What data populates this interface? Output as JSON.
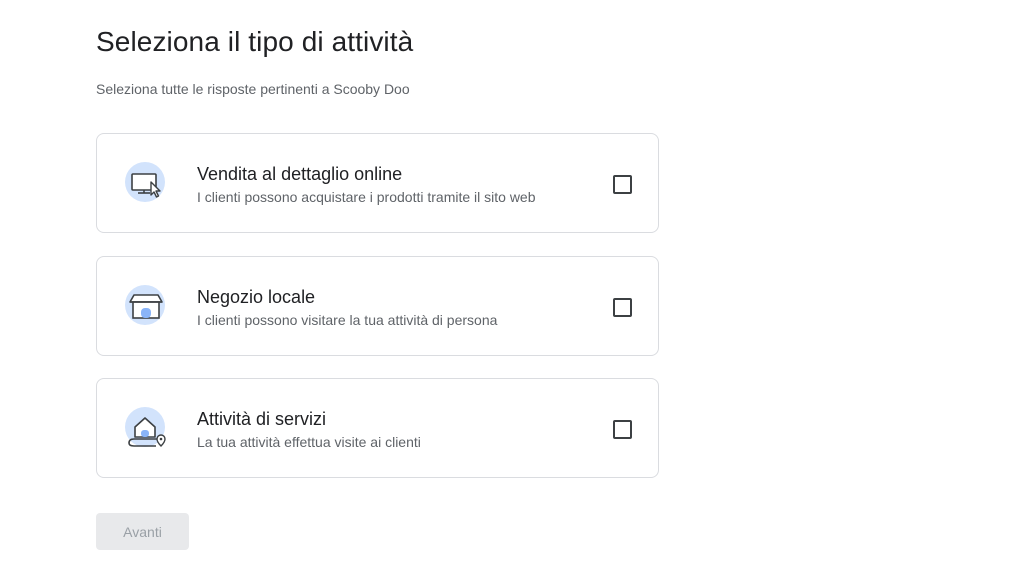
{
  "header": {
    "title": "Seleziona il tipo di attività",
    "subtitle": "Seleziona tutte le risposte pertinenti a Scooby Doo"
  },
  "options": [
    {
      "icon": "computer-cursor-icon",
      "title": "Vendita al dettaglio online",
      "description": "I clienti possono acquistare i prodotti tramite il sito web",
      "checked": false
    },
    {
      "icon": "storefront-icon",
      "title": "Negozio locale",
      "description": "I clienti possono visitare la tua attività di persona",
      "checked": false
    },
    {
      "icon": "house-location-icon",
      "title": "Attività di servizi",
      "description": "La tua attività effettua visite ai clienti",
      "checked": false
    }
  ],
  "footer": {
    "next_label": "Avanti",
    "next_enabled": false
  },
  "colors": {
    "icon_circle": "#d2e3fc",
    "icon_stroke": "#3c4043",
    "border": "#dadce0",
    "disabled_button_bg": "#e8e9eb",
    "disabled_button_text": "#9aa0a6"
  }
}
